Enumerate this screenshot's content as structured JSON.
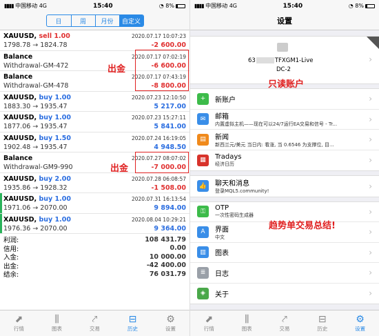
{
  "status": {
    "carrier": "中国移动",
    "net": "4G",
    "time": "15:40",
    "battery": "8%"
  },
  "history": {
    "tabs": [
      "日",
      "周",
      "月份",
      "自定义"
    ],
    "active_tab": 3,
    "trades": [
      {
        "symbol": "XAUUSD,",
        "side": "sell 1.00",
        "side_type": "sell",
        "time": "2020.07.17 10:07:23",
        "prices": "1798.78 → 1824.78",
        "profit": "-2 600.00",
        "sign": "neg"
      },
      {
        "symbol": "Balance",
        "side": "",
        "side_type": "",
        "time": "2020.07.17 07:02:19",
        "prices": "Withdrawal-GM-472",
        "profit": "-6 600.00",
        "sign": "neg"
      },
      {
        "symbol": "Balance",
        "side": "",
        "side_type": "",
        "time": "2020.07.17 07:43:19",
        "prices": "Withdrawal-GM-478",
        "profit": "-8 800.00",
        "sign": "neg"
      },
      {
        "symbol": "XAUUSD,",
        "side": "buy 1.00",
        "side_type": "buy",
        "time": "2020.07.23 12:10:50",
        "prices": "1883.30 → 1935.47",
        "profit": "5 217.00",
        "sign": "pos"
      },
      {
        "symbol": "XAUUSD,",
        "side": "buy 1.00",
        "side_type": "buy",
        "time": "2020.07.23 15:27:11",
        "prices": "1877.06 → 1935.47",
        "profit": "5 841.00",
        "sign": "pos"
      },
      {
        "symbol": "XAUUSD,",
        "side": "buy 1.50",
        "side_type": "buy",
        "time": "2020.07.24 16:19:05",
        "prices": "1902.48 → 1935.47",
        "profit": "4 948.50",
        "sign": "pos"
      },
      {
        "symbol": "Balance",
        "side": "",
        "side_type": "",
        "time": "2020.07.27 08:07:02",
        "prices": "Withdrawal-GM9-990",
        "profit": "-7 000.00",
        "sign": "neg"
      },
      {
        "symbol": "XAUUSD,",
        "side": "buy 2.00",
        "side_type": "buy",
        "time": "2020.07.28 06:08:57",
        "prices": "1935.86 → 1928.32",
        "profit": "-1 508.00",
        "sign": "neg"
      },
      {
        "symbol": "XAUUSD,",
        "side": "buy 1.00",
        "side_type": "buy",
        "time": "2020.07.31 16:13:54",
        "prices": "1971.06 → 2070.00",
        "profit": "9 894.00",
        "sign": "pos",
        "open": true
      },
      {
        "symbol": "XAUUSD,",
        "side": "buy 1.00",
        "side_type": "buy",
        "time": "2020.08.04 10:29:21",
        "prices": "1976.36 → 2070.00",
        "profit": "9 364.00",
        "sign": "pos",
        "open": true
      }
    ],
    "summary": [
      {
        "label": "利润:",
        "value": "108 431.79"
      },
      {
        "label": "信用:",
        "value": "0.00"
      },
      {
        "label": "入金:",
        "value": "10 000.00"
      },
      {
        "label": "出金:",
        "value": "-42 400.00"
      },
      {
        "label": "结余:",
        "value": "76 031.79"
      }
    ],
    "annotations": [
      "出金",
      "出金"
    ]
  },
  "tabbar_left": {
    "items": [
      "行情",
      "图表",
      "交易",
      "历史",
      "设置"
    ],
    "active": 3
  },
  "settings": {
    "title": "设置",
    "account": {
      "number": "63",
      "name": "TFXGM1-Live",
      "server": "DC-2"
    },
    "annot_readonly": "只读账户",
    "annot_summary": "趋势单交易总结!",
    "items_a": [
      {
        "title": "新账户",
        "sub": "",
        "icon": "user-plus-icon",
        "color": "#3dbb4a"
      },
      {
        "title": "邮箱",
        "sub": "内置虚拟主机——现在可以24/7运行EA交易和信号 - Tr...",
        "icon": "mail-icon",
        "color": "#3a8ee8"
      },
      {
        "title": "新闻",
        "sub": "新西兰元/美元 当日内: 看涨, 当 0.6546 为支撑位, 目...",
        "icon": "book-icon",
        "color": "#f08a1c"
      },
      {
        "title": "Tradays",
        "sub": "经济日历",
        "icon": "calendar-icon",
        "color": "#d8332b"
      }
    ],
    "items_b": [
      {
        "title": "聊天和消息",
        "sub": "登录MQL5.community!",
        "icon": "thumbs-up-icon",
        "color": "#3a8ee8"
      }
    ],
    "items_c": [
      {
        "title": "OTP",
        "sub": "一次性密码生成器",
        "icon": "key-icon",
        "color": "#3dbb4a"
      },
      {
        "title": "界面",
        "sub": "中文",
        "icon": "language-icon",
        "color": "#3a8ee8"
      },
      {
        "title": "图表",
        "sub": "",
        "icon": "chart-settings-icon",
        "color": "#3a8ee8"
      },
      {
        "title": "日志",
        "sub": "",
        "icon": "journal-icon",
        "color": "#9aa0a8"
      },
      {
        "title": "关于",
        "sub": "",
        "icon": "about-icon",
        "color": "#4aa84a"
      }
    ]
  },
  "tabbar_right": {
    "items": [
      "行情",
      "图表",
      "交易",
      "历史",
      "设置"
    ],
    "active": 4
  }
}
